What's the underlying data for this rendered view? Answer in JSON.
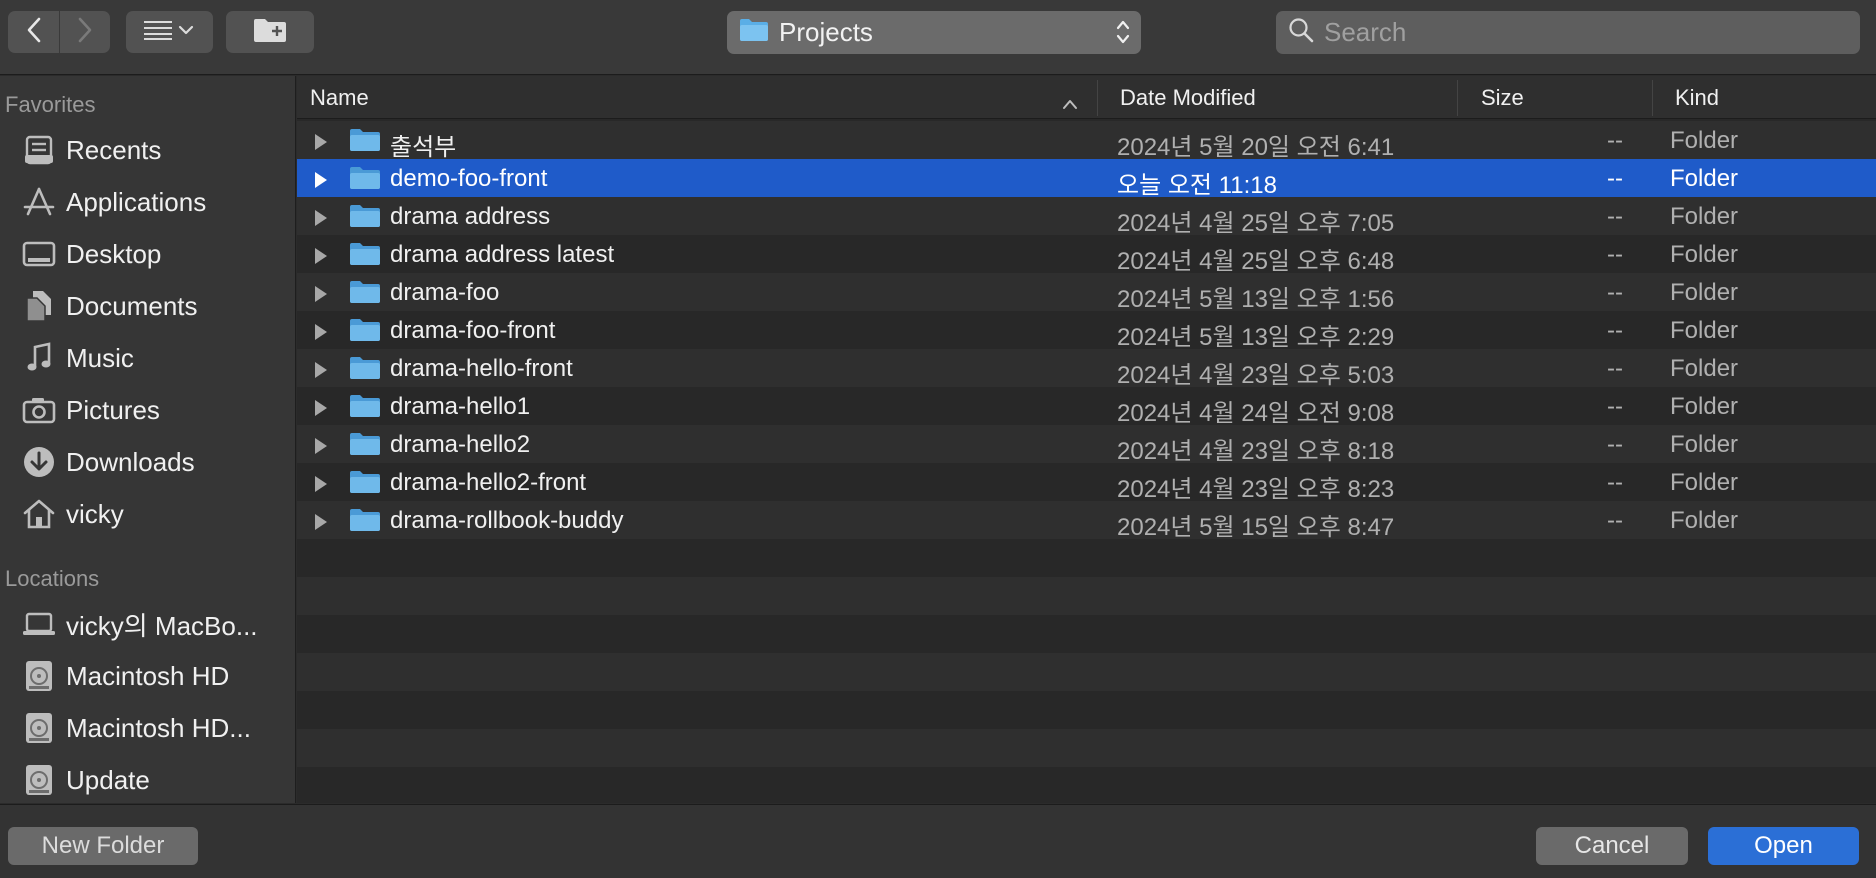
{
  "toolbar": {
    "back_icon": "chevron-left-icon",
    "forward_icon": "chevron-right-icon",
    "view_icon": "list-view-icon",
    "new_folder_icon": "folder-plus-icon",
    "location": "Projects",
    "search_placeholder": "Search"
  },
  "sidebar": {
    "favorites_title": "Favorites",
    "favorites": [
      {
        "label": "Recents",
        "icon": "recents-icon"
      },
      {
        "label": "Applications",
        "icon": "applications-icon"
      },
      {
        "label": "Desktop",
        "icon": "desktop-icon"
      },
      {
        "label": "Documents",
        "icon": "documents-icon"
      },
      {
        "label": "Music",
        "icon": "music-icon"
      },
      {
        "label": "Pictures",
        "icon": "pictures-icon"
      },
      {
        "label": "Downloads",
        "icon": "downloads-icon"
      },
      {
        "label": "vicky",
        "icon": "home-icon"
      }
    ],
    "locations_title": "Locations",
    "locations": [
      {
        "label": "vicky의 MacBo...",
        "icon": "laptop-icon"
      },
      {
        "label": "Macintosh HD",
        "icon": "disk-icon"
      },
      {
        "label": "Macintosh HD...",
        "icon": "disk-icon"
      },
      {
        "label": "Update",
        "icon": "disk-icon"
      }
    ]
  },
  "list": {
    "columns": {
      "name": "Name",
      "date": "Date Modified",
      "size": "Size",
      "kind": "Kind"
    },
    "sort": "name-ascending",
    "selected_index": 1,
    "rows": [
      {
        "name": "출석부",
        "date": "2024년 5월 20일 오전 6:41",
        "size": "--",
        "kind": "Folder"
      },
      {
        "name": "demo-foo-front",
        "date": "오늘 오전 11:18",
        "size": "--",
        "kind": "Folder"
      },
      {
        "name": "drama address",
        "date": "2024년 4월 25일 오후 7:05",
        "size": "--",
        "kind": "Folder"
      },
      {
        "name": "drama address latest",
        "date": "2024년 4월 25일 오후 6:48",
        "size": "--",
        "kind": "Folder"
      },
      {
        "name": "drama-foo",
        "date": "2024년 5월 13일 오후 1:56",
        "size": "--",
        "kind": "Folder"
      },
      {
        "name": "drama-foo-front",
        "date": "2024년 5월 13일 오후 2:29",
        "size": "--",
        "kind": "Folder"
      },
      {
        "name": "drama-hello-front",
        "date": "2024년 4월 23일 오후 5:03",
        "size": "--",
        "kind": "Folder"
      },
      {
        "name": "drama-hello1",
        "date": "2024년 4월 24일 오전 9:08",
        "size": "--",
        "kind": "Folder"
      },
      {
        "name": "drama-hello2",
        "date": "2024년 4월 23일 오후 8:18",
        "size": "--",
        "kind": "Folder"
      },
      {
        "name": "drama-hello2-front",
        "date": "2024년 4월 23일 오후 8:23",
        "size": "--",
        "kind": "Folder"
      },
      {
        "name": "drama-rollbook-buddy",
        "date": "2024년 5월 15일 오후 8:47",
        "size": "--",
        "kind": "Folder"
      }
    ]
  },
  "buttons": {
    "new_folder": "New Folder",
    "cancel": "Cancel",
    "open": "Open"
  },
  "colors": {
    "selection": "#1f5bc9",
    "folder": "#5aaee6",
    "primary_button": "#2b6fd6"
  }
}
